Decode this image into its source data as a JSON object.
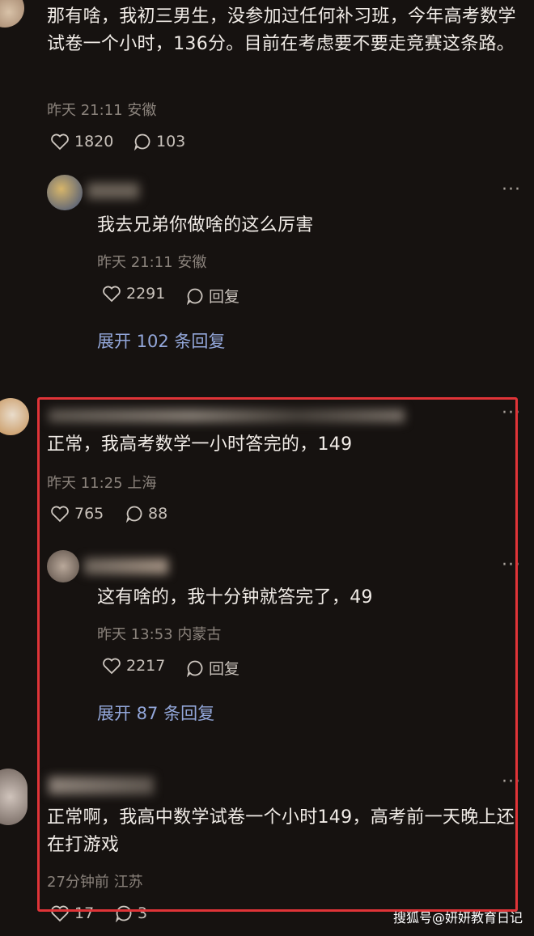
{
  "comment1": {
    "text": "那有啥，我初三男生，没参加过任何补习班，今年高考数学试卷一个小时，136分。目前在考虑要不要走竞赛这条路。",
    "meta": "昨天 21:11 安徽",
    "likes": "1820",
    "replies": "103"
  },
  "reply1": {
    "text": "我去兄弟你做啥的这么厉害",
    "meta": "昨天 21:11 安徽",
    "likes": "2291",
    "reply_label": "回复",
    "expand": "展开 102 条回复"
  },
  "comment2": {
    "text": "正常，我高考数学一小时答完的，149",
    "meta": "昨天 11:25 上海",
    "likes": "765",
    "replies": "88"
  },
  "reply2": {
    "text": "这有啥的，我十分钟就答完了，49",
    "meta": "昨天 13:53 内蒙古",
    "likes": "2217",
    "reply_label": "回复",
    "expand": "展开 87 条回复"
  },
  "comment3": {
    "text": "正常啊，我高中数学试卷一个小时149，高考前一天晚上还在打游戏",
    "meta": "27分钟前 江苏",
    "likes": "17",
    "replies": "3"
  },
  "more_label": "···",
  "watermark": "搜狐号@妍妍教育日记",
  "colors": {
    "highlight": "#e03438",
    "link": "#93a7da",
    "background": "#161210"
  }
}
